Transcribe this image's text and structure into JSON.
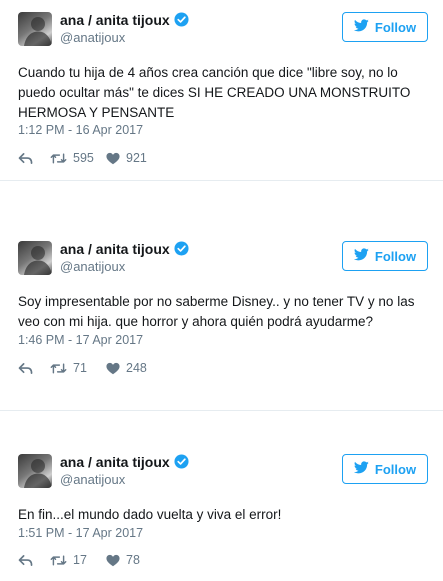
{
  "colors": {
    "accent": "#1da1f2",
    "muted": "#657786",
    "text": "#14171a",
    "verified": "#1da1f2"
  },
  "icons": {
    "follow": "twitter-bird-icon",
    "reply": "reply-icon",
    "retweet": "retweet-icon",
    "like": "heart-icon",
    "verified": "verified-badge-icon"
  },
  "tweets": [
    {
      "name": "ana / anita tijoux",
      "handle": "@anatijoux",
      "follow_label": "Follow",
      "text": "Cuando tu hija de 4 años crea canción que dice \"libre soy, no lo puedo ocultar más\" te dices SI HE CREADO UNA MONSTRUITO HERMOSA Y PENSANTE",
      "timestamp": "1:12 PM - 16 Apr 2017",
      "retweets": "595",
      "likes": "921"
    },
    {
      "name": "ana / anita tijoux",
      "handle": "@anatijoux",
      "follow_label": "Follow",
      "text": "Soy impresentable por no saberme Disney.. y no tener TV y no las veo con mi hija. que horror y ahora quién podrá ayudarme?",
      "timestamp": "1:46 PM - 17 Apr 2017",
      "retweets": "71",
      "likes": "248"
    },
    {
      "name": "ana / anita tijoux",
      "handle": "@anatijoux",
      "follow_label": "Follow",
      "text": "En fin...el mundo dado vuelta y viva el error!",
      "timestamp": "1:51 PM - 17 Apr 2017",
      "retweets": "17",
      "likes": "78"
    }
  ]
}
